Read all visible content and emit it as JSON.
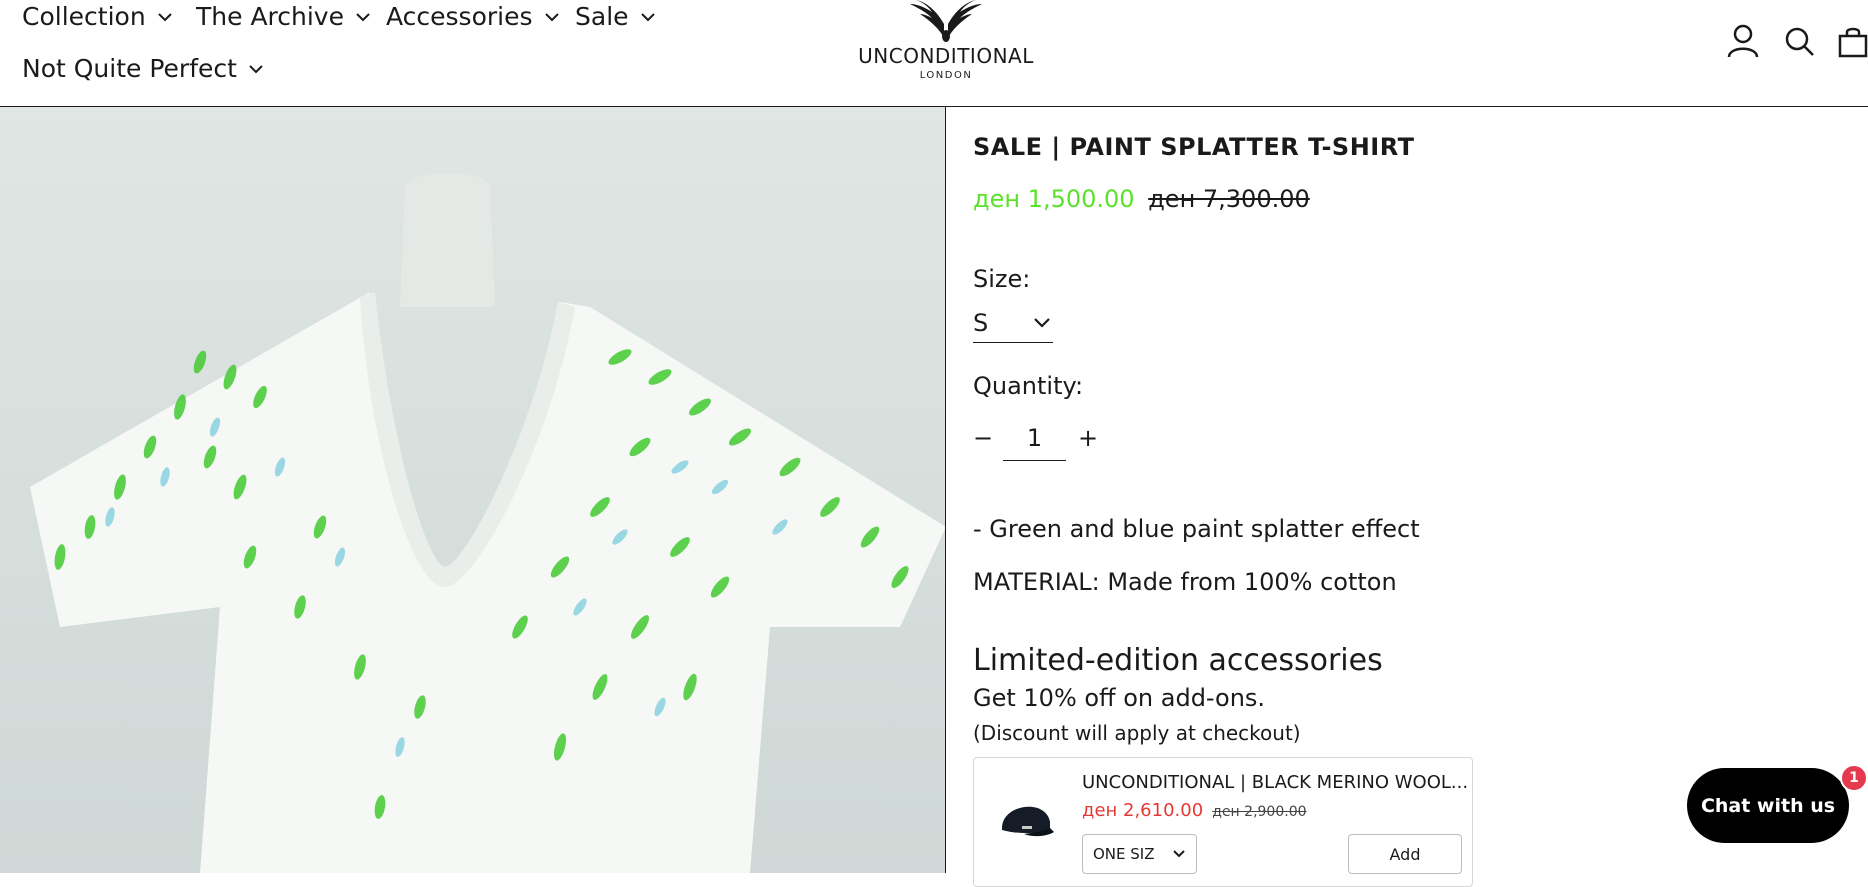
{
  "nav": {
    "items": [
      {
        "label": "Collection"
      },
      {
        "label": "The Archive"
      },
      {
        "label": "Accessories"
      },
      {
        "label": "Sale"
      },
      {
        "label": "Not Quite Perfect"
      }
    ]
  },
  "brand": {
    "name": "UNCONDITIONAL",
    "subtitle": "LONDON"
  },
  "header_icons": [
    "account-icon",
    "search-icon",
    "cart-icon"
  ],
  "product": {
    "title": "SALE | PAINT SPLATTER T-SHIRT",
    "sale_price": "ден 1,500.00",
    "compare_price": "ден 7,300.00",
    "size_label": "Size:",
    "size_value": "S",
    "quantity_label": "Quantity:",
    "quantity_minus": "−",
    "quantity_value": "1",
    "quantity_plus": "+",
    "description_line": "- Green and blue paint splatter effect",
    "material_line": "MATERIAL: Made from 100% cotton"
  },
  "accessories": {
    "title": "Limited-edition accessories",
    "subtitle": "Get 10% off on add-ons.",
    "note": "(Discount will apply at checkout)",
    "item": {
      "name": "UNCONDITIONAL | BLACK MERINO WOOL...",
      "sale_price": "ден 2,610.00",
      "compare_price": "ден 2,900.00",
      "size_value": "ONE SIZ",
      "add_label": "Add"
    }
  },
  "chat": {
    "label": "Chat with us",
    "badge": "1"
  },
  "colors": {
    "sale_green": "#5be22a",
    "sale_red": "#e53935",
    "text": "#1a1a1a",
    "chat_bg": "#000000",
    "badge": "#e53950"
  }
}
